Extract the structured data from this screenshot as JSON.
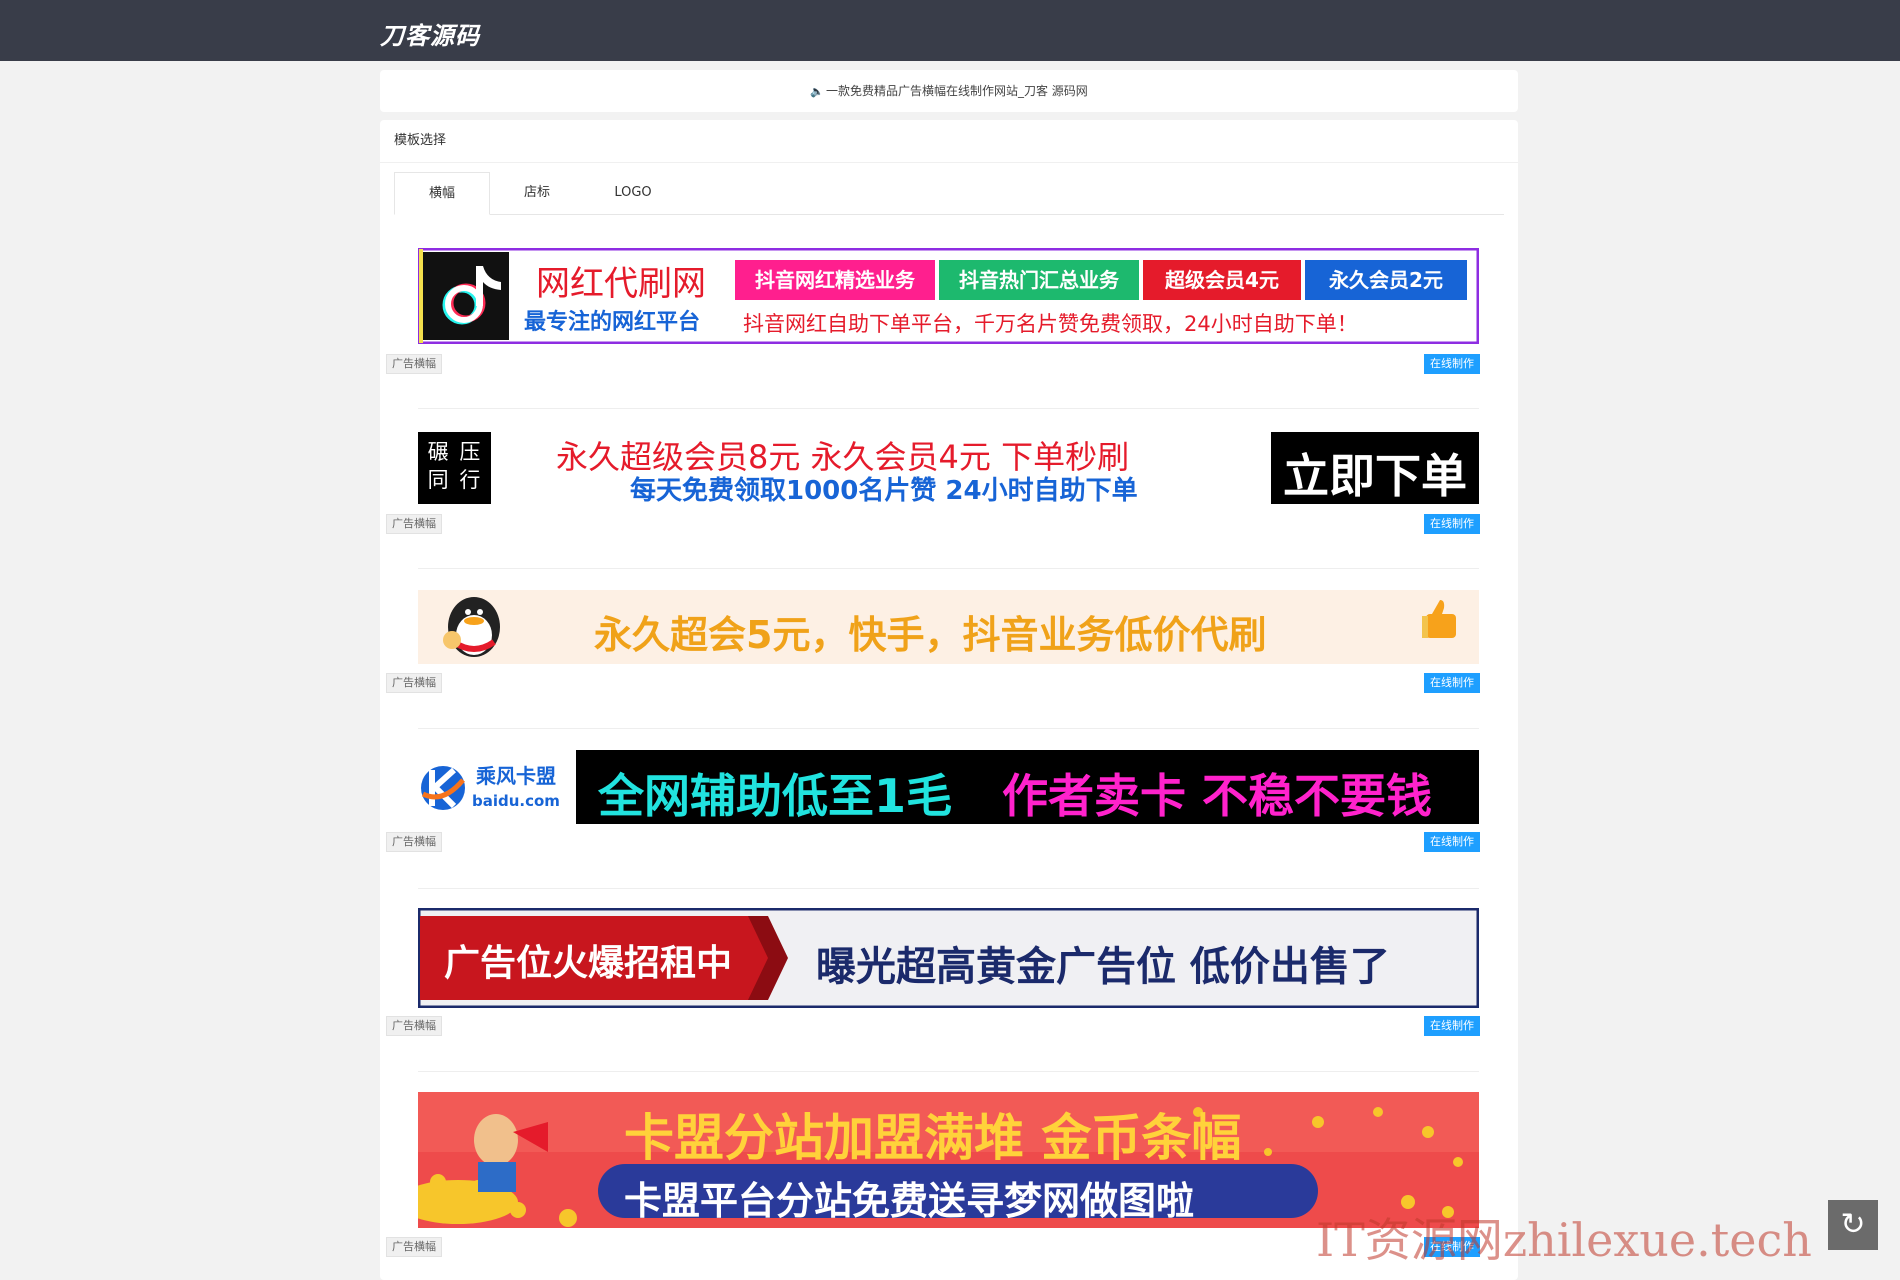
{
  "header": {
    "logo": "刀客源码"
  },
  "notice": {
    "icon": "speaker-icon",
    "text": "一款免费精品广告横幅在线制作网站_刀客 源码网"
  },
  "panel": {
    "title": "模板选择"
  },
  "tabs": [
    {
      "label": "横幅"
    },
    {
      "label": "店标"
    },
    {
      "label": "LOGO"
    }
  ],
  "tag_left": "广告横幅",
  "tag_right": "在线制作",
  "banners": [
    {
      "title": "网红代刷网",
      "subtitle": "最专注的网红平台",
      "chips": [
        "抖音网红精选业务",
        "抖音热门汇总业务",
        "超级会员4元",
        "永久会员2元"
      ],
      "slogan": "抖音网红自助下单平台，千万名片赞免费领取，24小时自助下单！"
    },
    {
      "logo_text": "碾 压 同 行",
      "line1": "永久超级会员8元  永久会员4元  下单秒刷",
      "line2": "每天免费领取1000名片赞  24小时自助下单",
      "button": "立即下单"
    },
    {
      "text": "永久超会5元，快手，抖音业务低价代刷"
    },
    {
      "brand": "乘风卡盟",
      "domain": "baidu.com",
      "part1": "全网辅助低至1毛",
      "part2": "作者卖卡 不稳不要钱"
    },
    {
      "left": "广告位火爆招租中",
      "right": "曝光超高黄金广告位 低价出售了"
    },
    {
      "line1": "卡盟分站加盟满堆 金币条幅",
      "line2": "卡盟平台分站免费送寻梦网做图啦"
    }
  ],
  "watermark": "IT资源网zhilexue.tech",
  "colors": {
    "topbar": "#393d49",
    "accent_blue": "#1e9fff",
    "pink": "#ff1f8e",
    "green": "#1db96e",
    "red": "#e51b2b",
    "blue": "#1764d6"
  }
}
